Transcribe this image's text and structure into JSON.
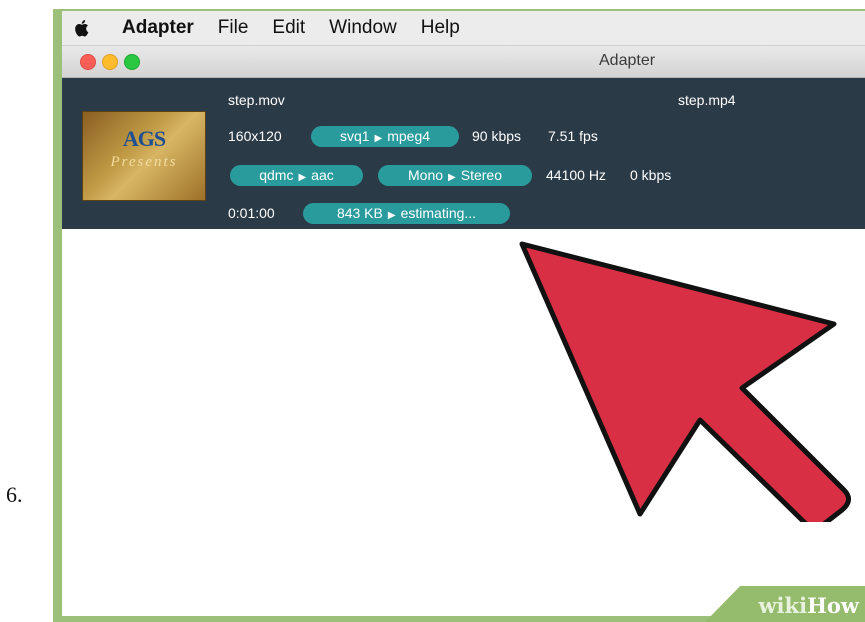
{
  "step": {
    "number": "6."
  },
  "menubar": {
    "apple_icon": "apple-logo-icon",
    "items": [
      {
        "label": "Adapter",
        "bold": true
      },
      {
        "label": "File"
      },
      {
        "label": "Edit"
      },
      {
        "label": "Window"
      },
      {
        "label": "Help"
      }
    ]
  },
  "window": {
    "title": "Adapter"
  },
  "file": {
    "thumbnail_logo": "AGS",
    "thumbnail_subtitle": "Presents",
    "source_name": "step.mov",
    "output_name": "step.mp4",
    "video": {
      "resolution": "160x120",
      "codec_from": "svq1",
      "codec_to": "mpeg4",
      "bitrate": "90 kbps",
      "fps": "7.51 fps"
    },
    "audio": {
      "codec_from": "qdmc",
      "codec_to": "aac",
      "channels_from": "Mono",
      "channels_to": "Stereo",
      "sample_rate": "44100 Hz",
      "bitrate": "0 kbps"
    },
    "duration": "0:01:00",
    "size_from": "843 KB",
    "size_to": "estimating..."
  },
  "overlay": {
    "pointer": "red-pointer-arrow",
    "color": "#d92f45"
  },
  "watermark": {
    "wiki": "wiki",
    "how": "How"
  },
  "colors": {
    "panel": "#2b3a47",
    "pill": "#2a9b9d",
    "frame": "#9cc079"
  }
}
